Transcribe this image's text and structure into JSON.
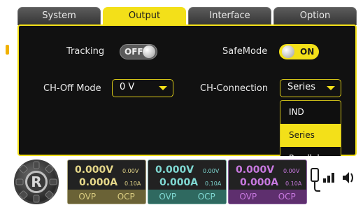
{
  "tabs": [
    {
      "label": "System",
      "active": false
    },
    {
      "label": "Output",
      "active": true
    },
    {
      "label": "Interface",
      "active": false
    },
    {
      "label": "Option",
      "active": false
    }
  ],
  "settings": {
    "tracking": {
      "label": "Tracking",
      "state": "OFF"
    },
    "safemode": {
      "label": "SafeMode",
      "state": "ON"
    },
    "ch_off_mode": {
      "label": "CH-Off Mode",
      "value": "0 V"
    },
    "ch_connection": {
      "label": "CH-Connection",
      "value": "Series"
    }
  },
  "dropdown": {
    "options": [
      "IND",
      "Series",
      "Parallel"
    ],
    "selected": "Series"
  },
  "channels": [
    {
      "voltage": "0.000V",
      "current": "0.000A",
      "set_voltage": "0.00V",
      "set_current": "0.10A",
      "ovp": "OVP",
      "ocp": "OCP",
      "color": "#e6d88a"
    },
    {
      "voltage": "0.000V",
      "current": "0.000A",
      "set_voltage": "0.00V",
      "set_current": "0.10A",
      "ovp": "OVP",
      "ocp": "OCP",
      "color": "#7fd8d2"
    },
    {
      "voltage": "0.000V",
      "current": "0.000A",
      "set_voltage": "0.00V",
      "set_current": "0.10A",
      "ovp": "OVP",
      "ocp": "OCP",
      "color": "#c879e0"
    }
  ],
  "logo_letter": "R",
  "icons": [
    "logo-gear-icon",
    "usb-icon",
    "network-icon",
    "speaker-icon"
  ],
  "colors": {
    "accent": "#f3e019",
    "panel": "#111111"
  }
}
